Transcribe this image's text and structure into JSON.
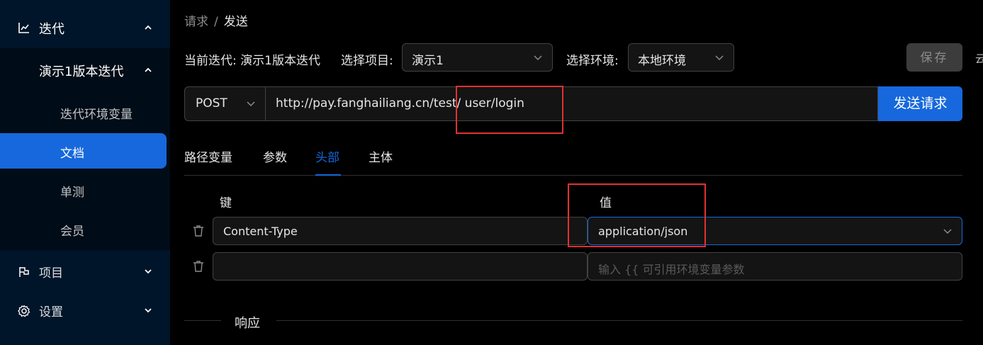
{
  "sidebar": {
    "menu_iteration": "迭代",
    "sub_iteration": "演示1版本迭代",
    "items": [
      {
        "label": "迭代环境变量"
      },
      {
        "label": "文档"
      },
      {
        "label": "单测"
      },
      {
        "label": "会员"
      }
    ],
    "menu_project": "项目",
    "menu_settings": "设置"
  },
  "breadcrumb": {
    "request": "请求",
    "separator": "/",
    "current": "发送"
  },
  "toolbar": {
    "current_iteration": "当前迭代: 演示1版本迭代",
    "project_label": "选择项目:",
    "project_value": "演示1",
    "env_label": "选择环境:",
    "env_value": "本地环境",
    "save_label": "保存",
    "edge_glyph": "云"
  },
  "request": {
    "method": "POST",
    "url": "http://pay.fanghailiang.cn/test/ user/login",
    "send_label": "发送请求"
  },
  "tabs": [
    {
      "label": "路径变量"
    },
    {
      "label": "参数"
    },
    {
      "label": "头部",
      "active": true
    },
    {
      "label": "主体"
    }
  ],
  "headers": {
    "key_col": "键",
    "value_col": "值",
    "rows": [
      {
        "key": "Content-Type",
        "value": "application/json"
      }
    ],
    "value_placeholder": "输入 {{ 可引用环境变量参数"
  },
  "response": {
    "title": "响应"
  },
  "colors": {
    "accent": "#1668dc",
    "sidebar": "#001529",
    "highlight_box": "#e03131"
  }
}
